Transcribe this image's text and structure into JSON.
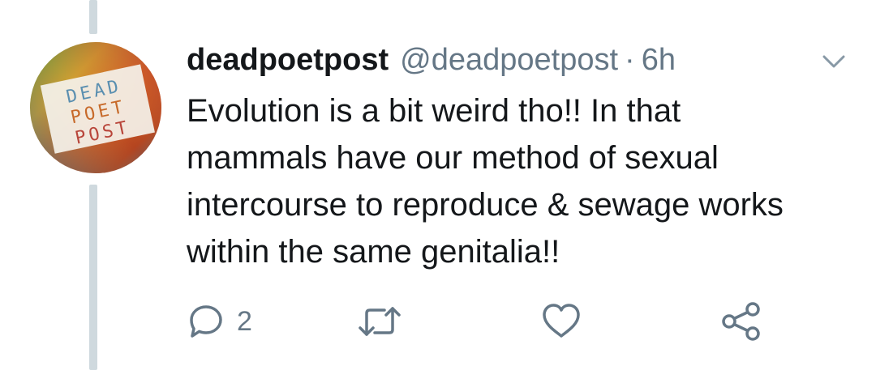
{
  "tweet": {
    "display_name": "deadpoetpost",
    "handle": "@deadpoetpost",
    "separator": "·",
    "time": "6h",
    "text": "Evolution is a bit weird tho!! In that mammals have our method of sexual intercourse to reproduce & sewage works within the same genitalia!!",
    "avatar": {
      "text_lines": [
        "DEAD",
        "POET",
        "POST"
      ]
    }
  },
  "actions": {
    "reply_count": "2",
    "retweet_count": "",
    "like_count": ""
  },
  "icons": {
    "reply": "reply-icon",
    "retweet": "retweet-icon",
    "like": "heart-icon",
    "share": "share-icon",
    "menu": "chevron-down-icon"
  },
  "colors": {
    "text_primary": "#14171a",
    "text_secondary": "#657786",
    "thread_line": "#cfd9de",
    "icon": "#657786"
  }
}
